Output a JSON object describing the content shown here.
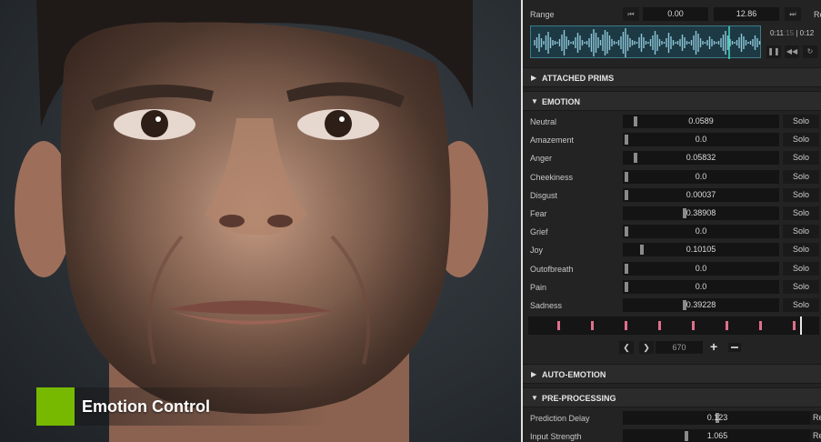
{
  "viewport": {
    "caption": "Emotion Control",
    "accent_color": "#76b900"
  },
  "range": {
    "label": "Range",
    "start_value": "0.00",
    "end_value": "12.86",
    "reset_clip": "Res",
    "time_current": "0:11",
    "time_frames": ":15",
    "time_separator": "|",
    "time_total": "0:12"
  },
  "sections": {
    "attached_prims": "ATTACHED PRIMS",
    "emotion": "EMOTION",
    "auto_emotion": "AUTO-EMOTION",
    "pre_processing": "PRE-PROCESSING"
  },
  "emotions": [
    {
      "label": "Neutral",
      "value": "0.0589",
      "level": 0.0589,
      "solo": "Solo"
    },
    {
      "label": "Amazement",
      "value": "0.0",
      "level": 0.0,
      "solo": "Solo"
    },
    {
      "label": "Anger",
      "value": "0.05832",
      "level": 0.05832,
      "solo": "Solo"
    },
    {
      "label": "Cheekiness",
      "value": "0.0",
      "level": 0.0,
      "solo": "Solo"
    },
    {
      "label": "Disgust",
      "value": "0.00037",
      "level": 0.00037,
      "solo": "Solo"
    },
    {
      "label": "Fear",
      "value": "0.38908",
      "level": 0.38908,
      "solo": "Solo"
    },
    {
      "label": "Grief",
      "value": "0.0",
      "level": 0.0,
      "solo": "Solo"
    },
    {
      "label": "Joy",
      "value": "0.10105",
      "level": 0.10105,
      "solo": "Solo"
    },
    {
      "label": "Outofbreath",
      "value": "0.0",
      "level": 0.0,
      "solo": "Solo"
    },
    {
      "label": "Pain",
      "value": "0.0",
      "level": 0.0,
      "solo": "Solo"
    },
    {
      "label": "Sadness",
      "value": "0.39228",
      "level": 0.39228,
      "solo": "Solo"
    }
  ],
  "keyframes": {
    "frame_value": "670",
    "key_color": "#e0708a"
  },
  "pre_processing": [
    {
      "label": "Prediction Delay",
      "value": "0.123",
      "level": 0.5,
      "reset": "Res"
    },
    {
      "label": "Input Strength",
      "value": "1.065",
      "level": 0.33,
      "reset": "Res"
    }
  ]
}
